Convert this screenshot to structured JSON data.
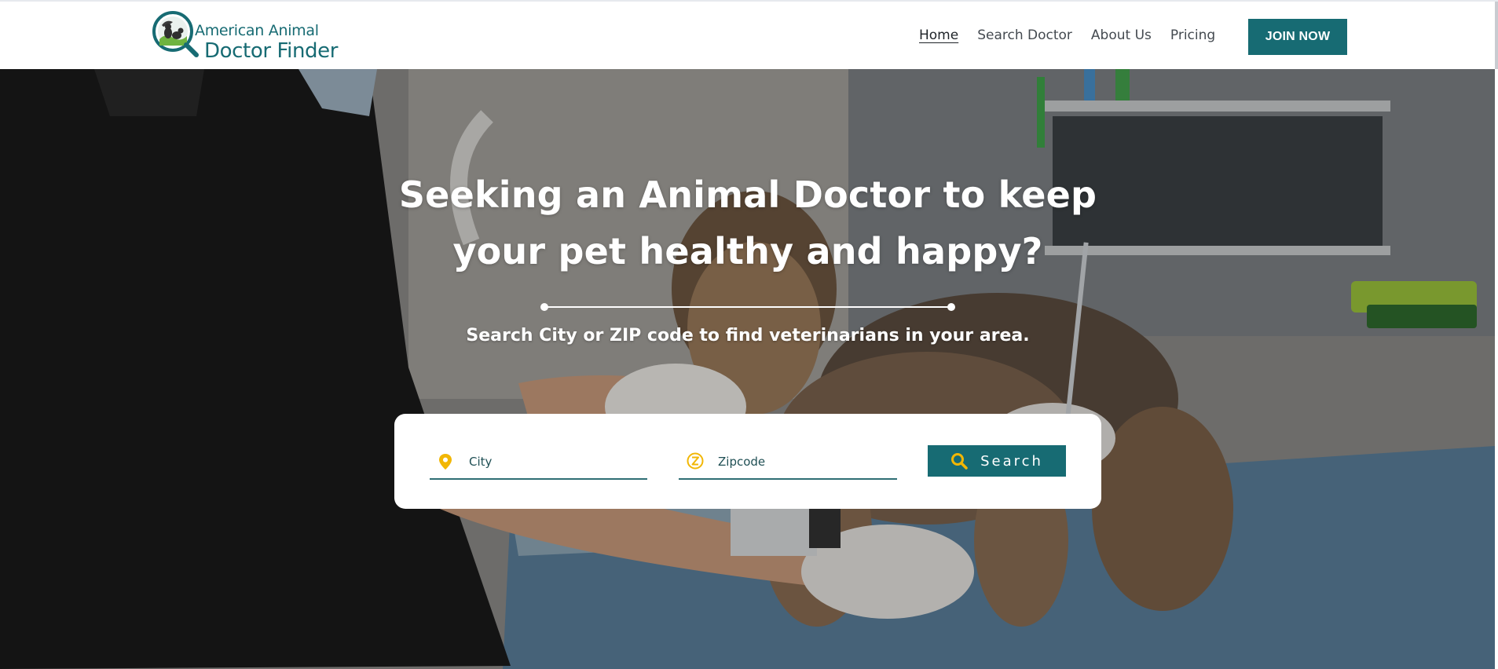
{
  "header": {
    "logo": {
      "line1": "American Animal",
      "line2": "Doctor Finder"
    },
    "nav": [
      {
        "label": "Home",
        "active": true
      },
      {
        "label": "Search Doctor",
        "active": false
      },
      {
        "label": "About Us",
        "active": false
      },
      {
        "label": "Pricing",
        "active": false
      }
    ],
    "cta_label": "JOIN NOW"
  },
  "hero": {
    "title": "Seeking an Animal Doctor to keep your pet healthy and happy?",
    "subtitle": "Search City or ZIP code to find veterinarians in your area."
  },
  "search": {
    "city_placeholder": "City",
    "zip_placeholder": "Zipcode",
    "button_label": "Search",
    "city_icon": "map-pin-icon",
    "zip_icon": "zipcode-circle-icon",
    "button_icon": "search-icon"
  },
  "colors": {
    "brand": "#176b73",
    "accent": "#f2b705",
    "text": "#444a50",
    "white": "#ffffff"
  }
}
